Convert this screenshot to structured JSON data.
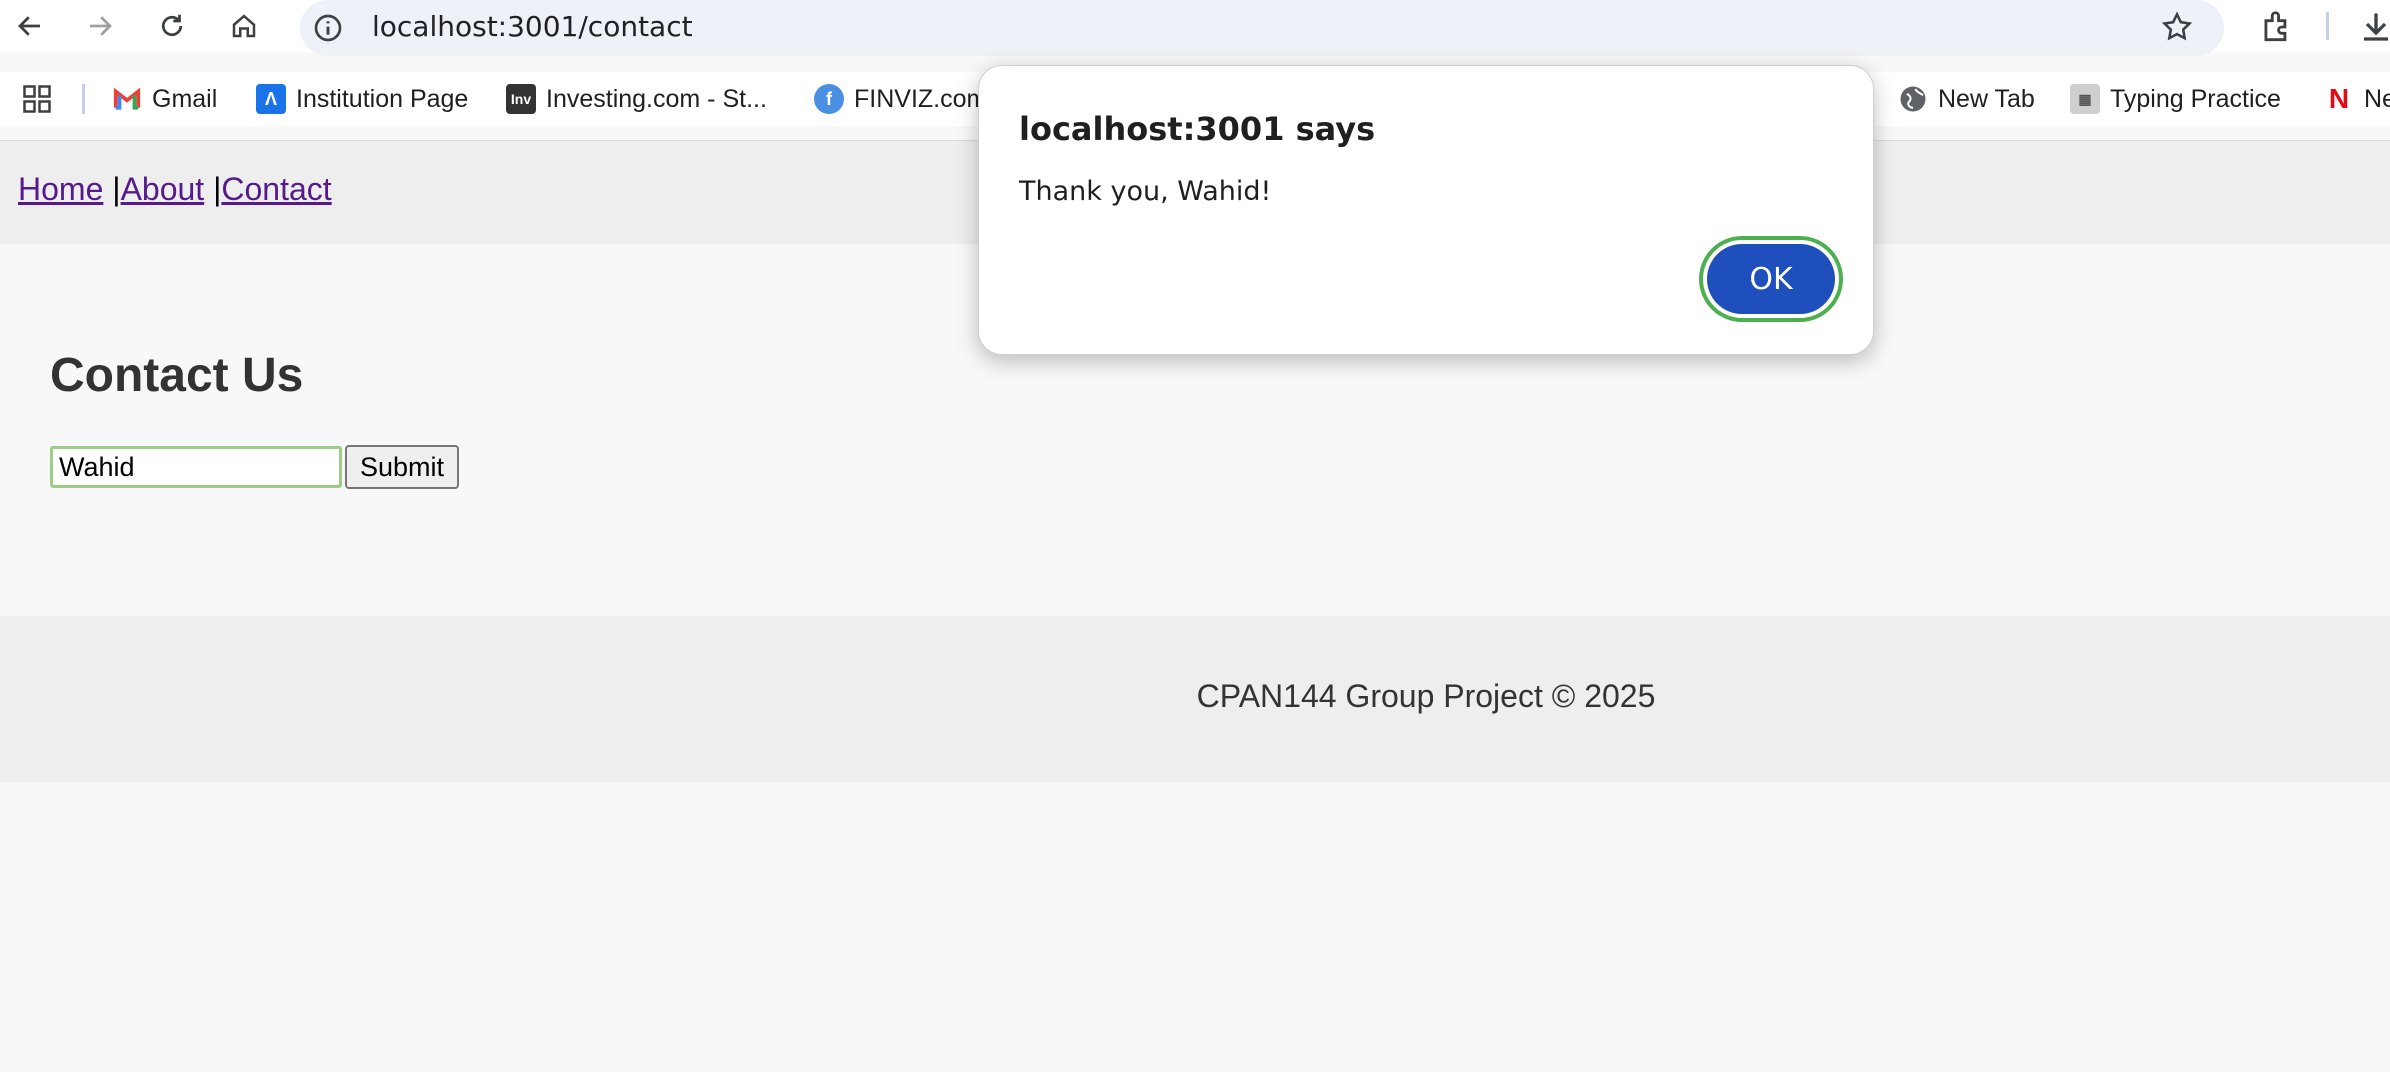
{
  "browser": {
    "url": "localhost:3001/contact",
    "bookmarks": [
      {
        "label": "Gmail",
        "icon": "gmail-icon",
        "color": "#ea4335"
      },
      {
        "label": "Institution Page",
        "icon": "institution-icon",
        "color": "#1a73e8"
      },
      {
        "label": "Investing.com - St...",
        "icon": "investing-icon",
        "color": "#333333",
        "glyph": "Inv"
      },
      {
        "label": "FINVIZ.com",
        "icon": "finviz-icon",
        "color": "#4a90e2"
      },
      {
        "label": "New Tab",
        "icon": "globe-icon",
        "color": "#5f6368"
      },
      {
        "label": "Typing Practice",
        "icon": "typing-icon",
        "color": "#888888"
      },
      {
        "label": "Ne",
        "icon": "netflix-icon",
        "color": "#e50914",
        "glyph": "N"
      }
    ]
  },
  "page": {
    "nav": {
      "home": "Home",
      "about": "About",
      "contact": "Contact",
      "separator": "|"
    },
    "heading": "Contact Us",
    "form": {
      "name_value": "Wahid",
      "submit_label": "Submit"
    },
    "footer": "CPAN144 Group Project © 2025"
  },
  "dialog": {
    "title": "localhost:3001 says",
    "message": "Thank you, Wahid!",
    "ok_label": "OK"
  }
}
